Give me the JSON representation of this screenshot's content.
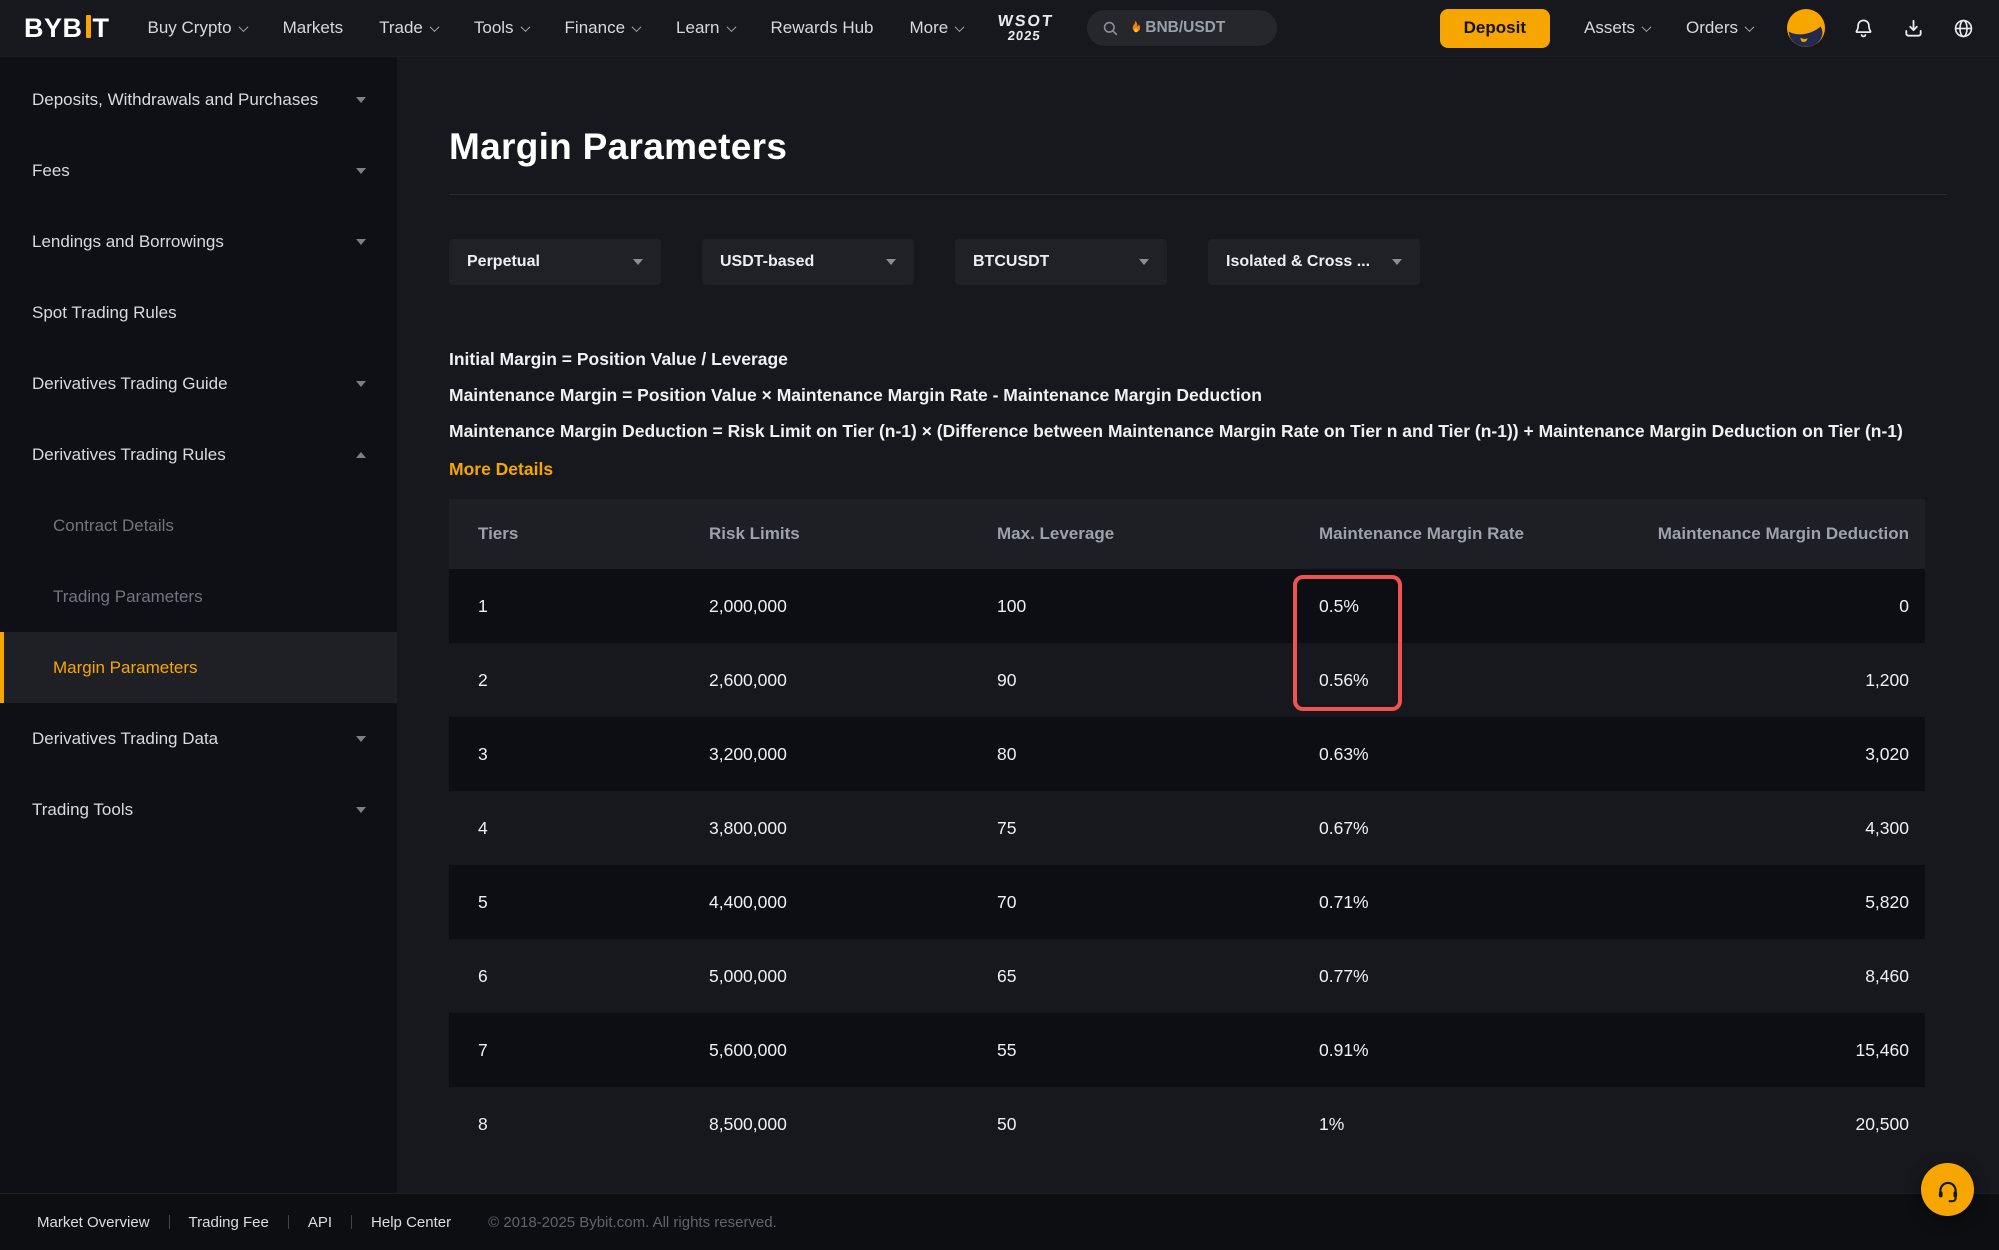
{
  "header": {
    "logo": {
      "part1": "BYB",
      "part2": "T"
    },
    "nav": [
      {
        "label": "Buy Crypto"
      },
      {
        "label": "Markets"
      },
      {
        "label": "Trade"
      },
      {
        "label": "Tools"
      },
      {
        "label": "Finance"
      },
      {
        "label": "Learn"
      },
      {
        "label": "Rewards Hub"
      },
      {
        "label": "More"
      }
    ],
    "wsot": {
      "line1": "WSOT",
      "line2": "2025"
    },
    "search": {
      "value": "BNB/USDT"
    },
    "deposit_label": "Deposit",
    "assets_label": "Assets",
    "orders_label": "Orders"
  },
  "sidebar": {
    "items": [
      {
        "label": "Deposits, Withdrawals and Purchases"
      },
      {
        "label": "Fees"
      },
      {
        "label": "Lendings and Borrowings"
      },
      {
        "label": "Spot Trading Rules"
      },
      {
        "label": "Derivatives Trading Guide"
      },
      {
        "label": "Derivatives Trading Rules"
      },
      {
        "label": "Contract Details"
      },
      {
        "label": "Trading Parameters"
      },
      {
        "label": "Margin Parameters"
      },
      {
        "label": "Derivatives Trading Data"
      },
      {
        "label": "Trading Tools"
      }
    ]
  },
  "main": {
    "title": "Margin Parameters",
    "filters": [
      "Perpetual",
      "USDT-based",
      "BTCUSDT",
      "Isolated & Cross ..."
    ],
    "formulas": [
      "Initial Margin = Position Value / Leverage",
      "Maintenance Margin = Position Value × Maintenance Margin Rate - Maintenance Margin Deduction",
      "Maintenance Margin Deduction = Risk Limit on Tier (n-1) × (Difference between Maintenance Margin Rate on Tier n and Tier (n-1)) + Maintenance Margin Deduction on Tier (n-1)"
    ],
    "more_details": "More Details",
    "table": {
      "columns": [
        "Tiers",
        "Risk Limits",
        "Max. Leverage",
        "Maintenance Margin Rate",
        "Maintenance Margin Deduction"
      ],
      "rows": [
        [
          "1",
          "2,000,000",
          "100",
          "0.5%",
          "0"
        ],
        [
          "2",
          "2,600,000",
          "90",
          "0.56%",
          "1,200"
        ],
        [
          "3",
          "3,200,000",
          "80",
          "0.63%",
          "3,020"
        ],
        [
          "4",
          "3,800,000",
          "75",
          "0.67%",
          "4,300"
        ],
        [
          "5",
          "4,400,000",
          "70",
          "0.71%",
          "5,820"
        ],
        [
          "6",
          "5,000,000",
          "65",
          "0.77%",
          "8,460"
        ],
        [
          "7",
          "5,600,000",
          "55",
          "0.91%",
          "15,460"
        ],
        [
          "8",
          "8,500,000",
          "50",
          "1%",
          "20,500"
        ]
      ],
      "highlight": {
        "rows": [
          1,
          2
        ],
        "column": "Maintenance Margin Rate",
        "color": "#f0534f"
      }
    }
  },
  "footer": {
    "links": [
      "Market Overview",
      "Trading Fee",
      "API",
      "Help Center"
    ],
    "copyright": "© 2018-2025 Bybit.com. All rights reserved."
  },
  "colors": {
    "accent": "#f7a600",
    "highlight_red": "#f0534f"
  }
}
